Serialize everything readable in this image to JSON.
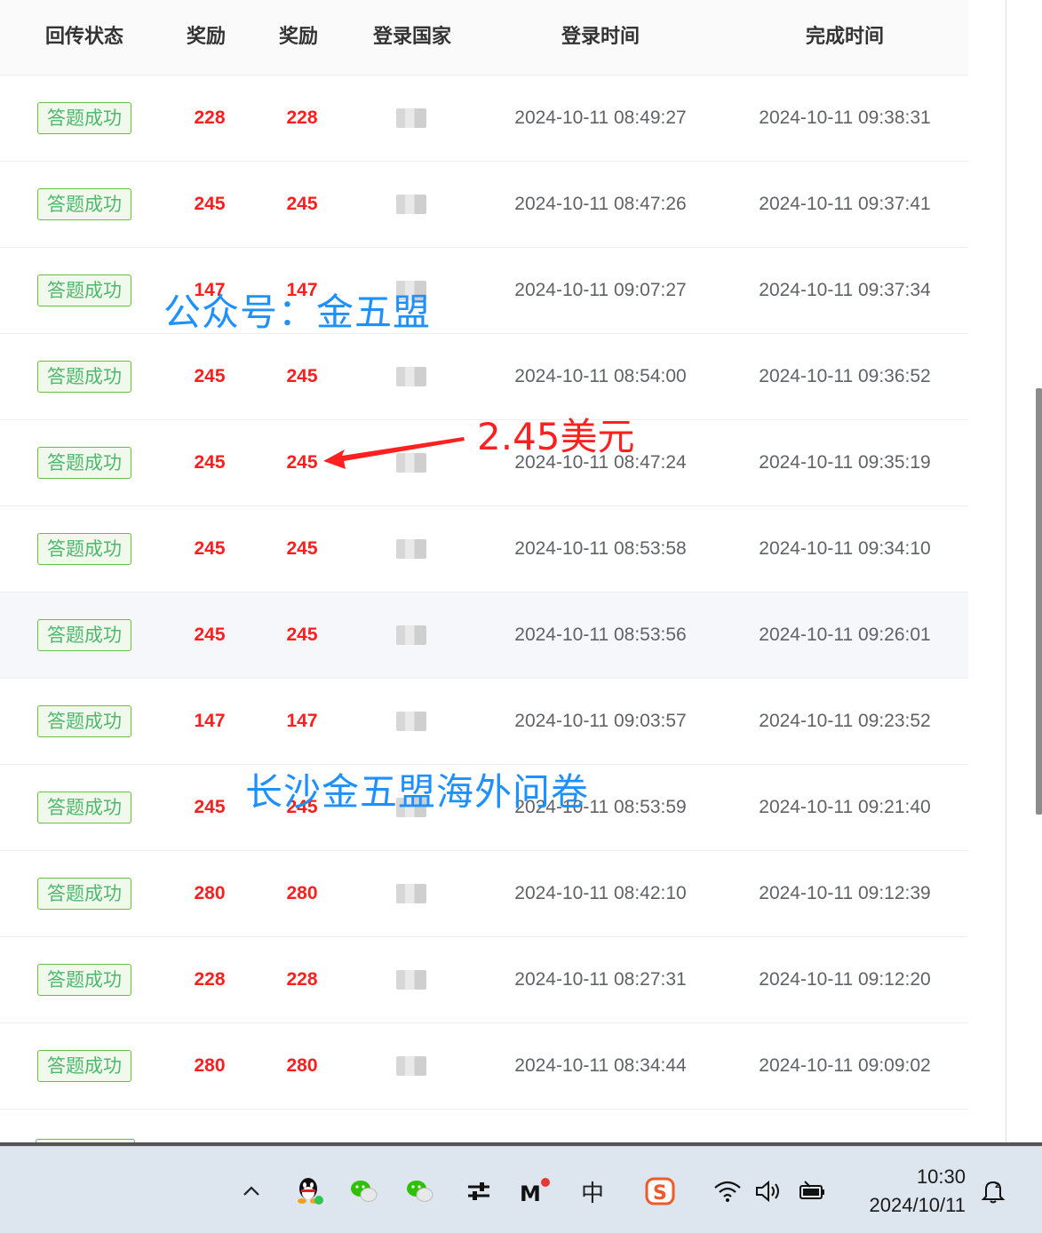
{
  "table": {
    "headers": [
      "回传状态",
      "奖励",
      "奖励",
      "登录国家",
      "登录时间",
      "完成时间"
    ],
    "rows": [
      {
        "status": "答题成功",
        "reward1": "228",
        "reward2": "228",
        "login": "2024-10-11 08:49:27",
        "done": "2024-10-11 09:38:31"
      },
      {
        "status": "答题成功",
        "reward1": "245",
        "reward2": "245",
        "login": "2024-10-11 08:47:26",
        "done": "2024-10-11 09:37:41"
      },
      {
        "status": "答题成功",
        "reward1": "147",
        "reward2": "147",
        "login": "2024-10-11 09:07:27",
        "done": "2024-10-11 09:37:34"
      },
      {
        "status": "答题成功",
        "reward1": "245",
        "reward2": "245",
        "login": "2024-10-11 08:54:00",
        "done": "2024-10-11 09:36:52"
      },
      {
        "status": "答题成功",
        "reward1": "245",
        "reward2": "245",
        "login": "2024-10-11 08:47:24",
        "done": "2024-10-11 09:35:19"
      },
      {
        "status": "答题成功",
        "reward1": "245",
        "reward2": "245",
        "login": "2024-10-11 08:53:58",
        "done": "2024-10-11 09:34:10"
      },
      {
        "status": "答题成功",
        "reward1": "245",
        "reward2": "245",
        "login": "2024-10-11 08:53:56",
        "done": "2024-10-11 09:26:01"
      },
      {
        "status": "答题成功",
        "reward1": "147",
        "reward2": "147",
        "login": "2024-10-11 09:03:57",
        "done": "2024-10-11 09:23:52"
      },
      {
        "status": "答题成功",
        "reward1": "245",
        "reward2": "245",
        "login": "2024-10-11 08:53:59",
        "done": "2024-10-11 09:21:40"
      },
      {
        "status": "答题成功",
        "reward1": "280",
        "reward2": "280",
        "login": "2024-10-11 08:42:10",
        "done": "2024-10-11 09:12:39"
      },
      {
        "status": "答题成功",
        "reward1": "228",
        "reward2": "228",
        "login": "2024-10-11 08:27:31",
        "done": "2024-10-11 09:12:20"
      },
      {
        "status": "答题成功",
        "reward1": "280",
        "reward2": "280",
        "login": "2024-10-11 08:34:44",
        "done": "2024-10-11 09:09:02"
      }
    ]
  },
  "overlay": {
    "watermark_top": "公众号：金五盟",
    "watermark_bottom": "长沙金五盟海外问卷",
    "annotation": "2.45美元"
  },
  "taskbar": {
    "time": "10:30",
    "date": "2024/10/11",
    "ime": "中",
    "icons": [
      "chevron-up-icon",
      "qq-icon",
      "wechat-icon",
      "wechat-icon",
      "settings-sliders-icon",
      "m-app-icon",
      "ime-icon",
      "sogou-icon",
      "wifi-icon",
      "volume-icon",
      "battery-icon",
      "notification-icon"
    ]
  },
  "colors": {
    "reward": "#ff1e1e",
    "tag_border": "#67c23a",
    "tag_text": "#4fb86f",
    "watermark": "#1e90ff",
    "annotation": "#ff2020"
  }
}
